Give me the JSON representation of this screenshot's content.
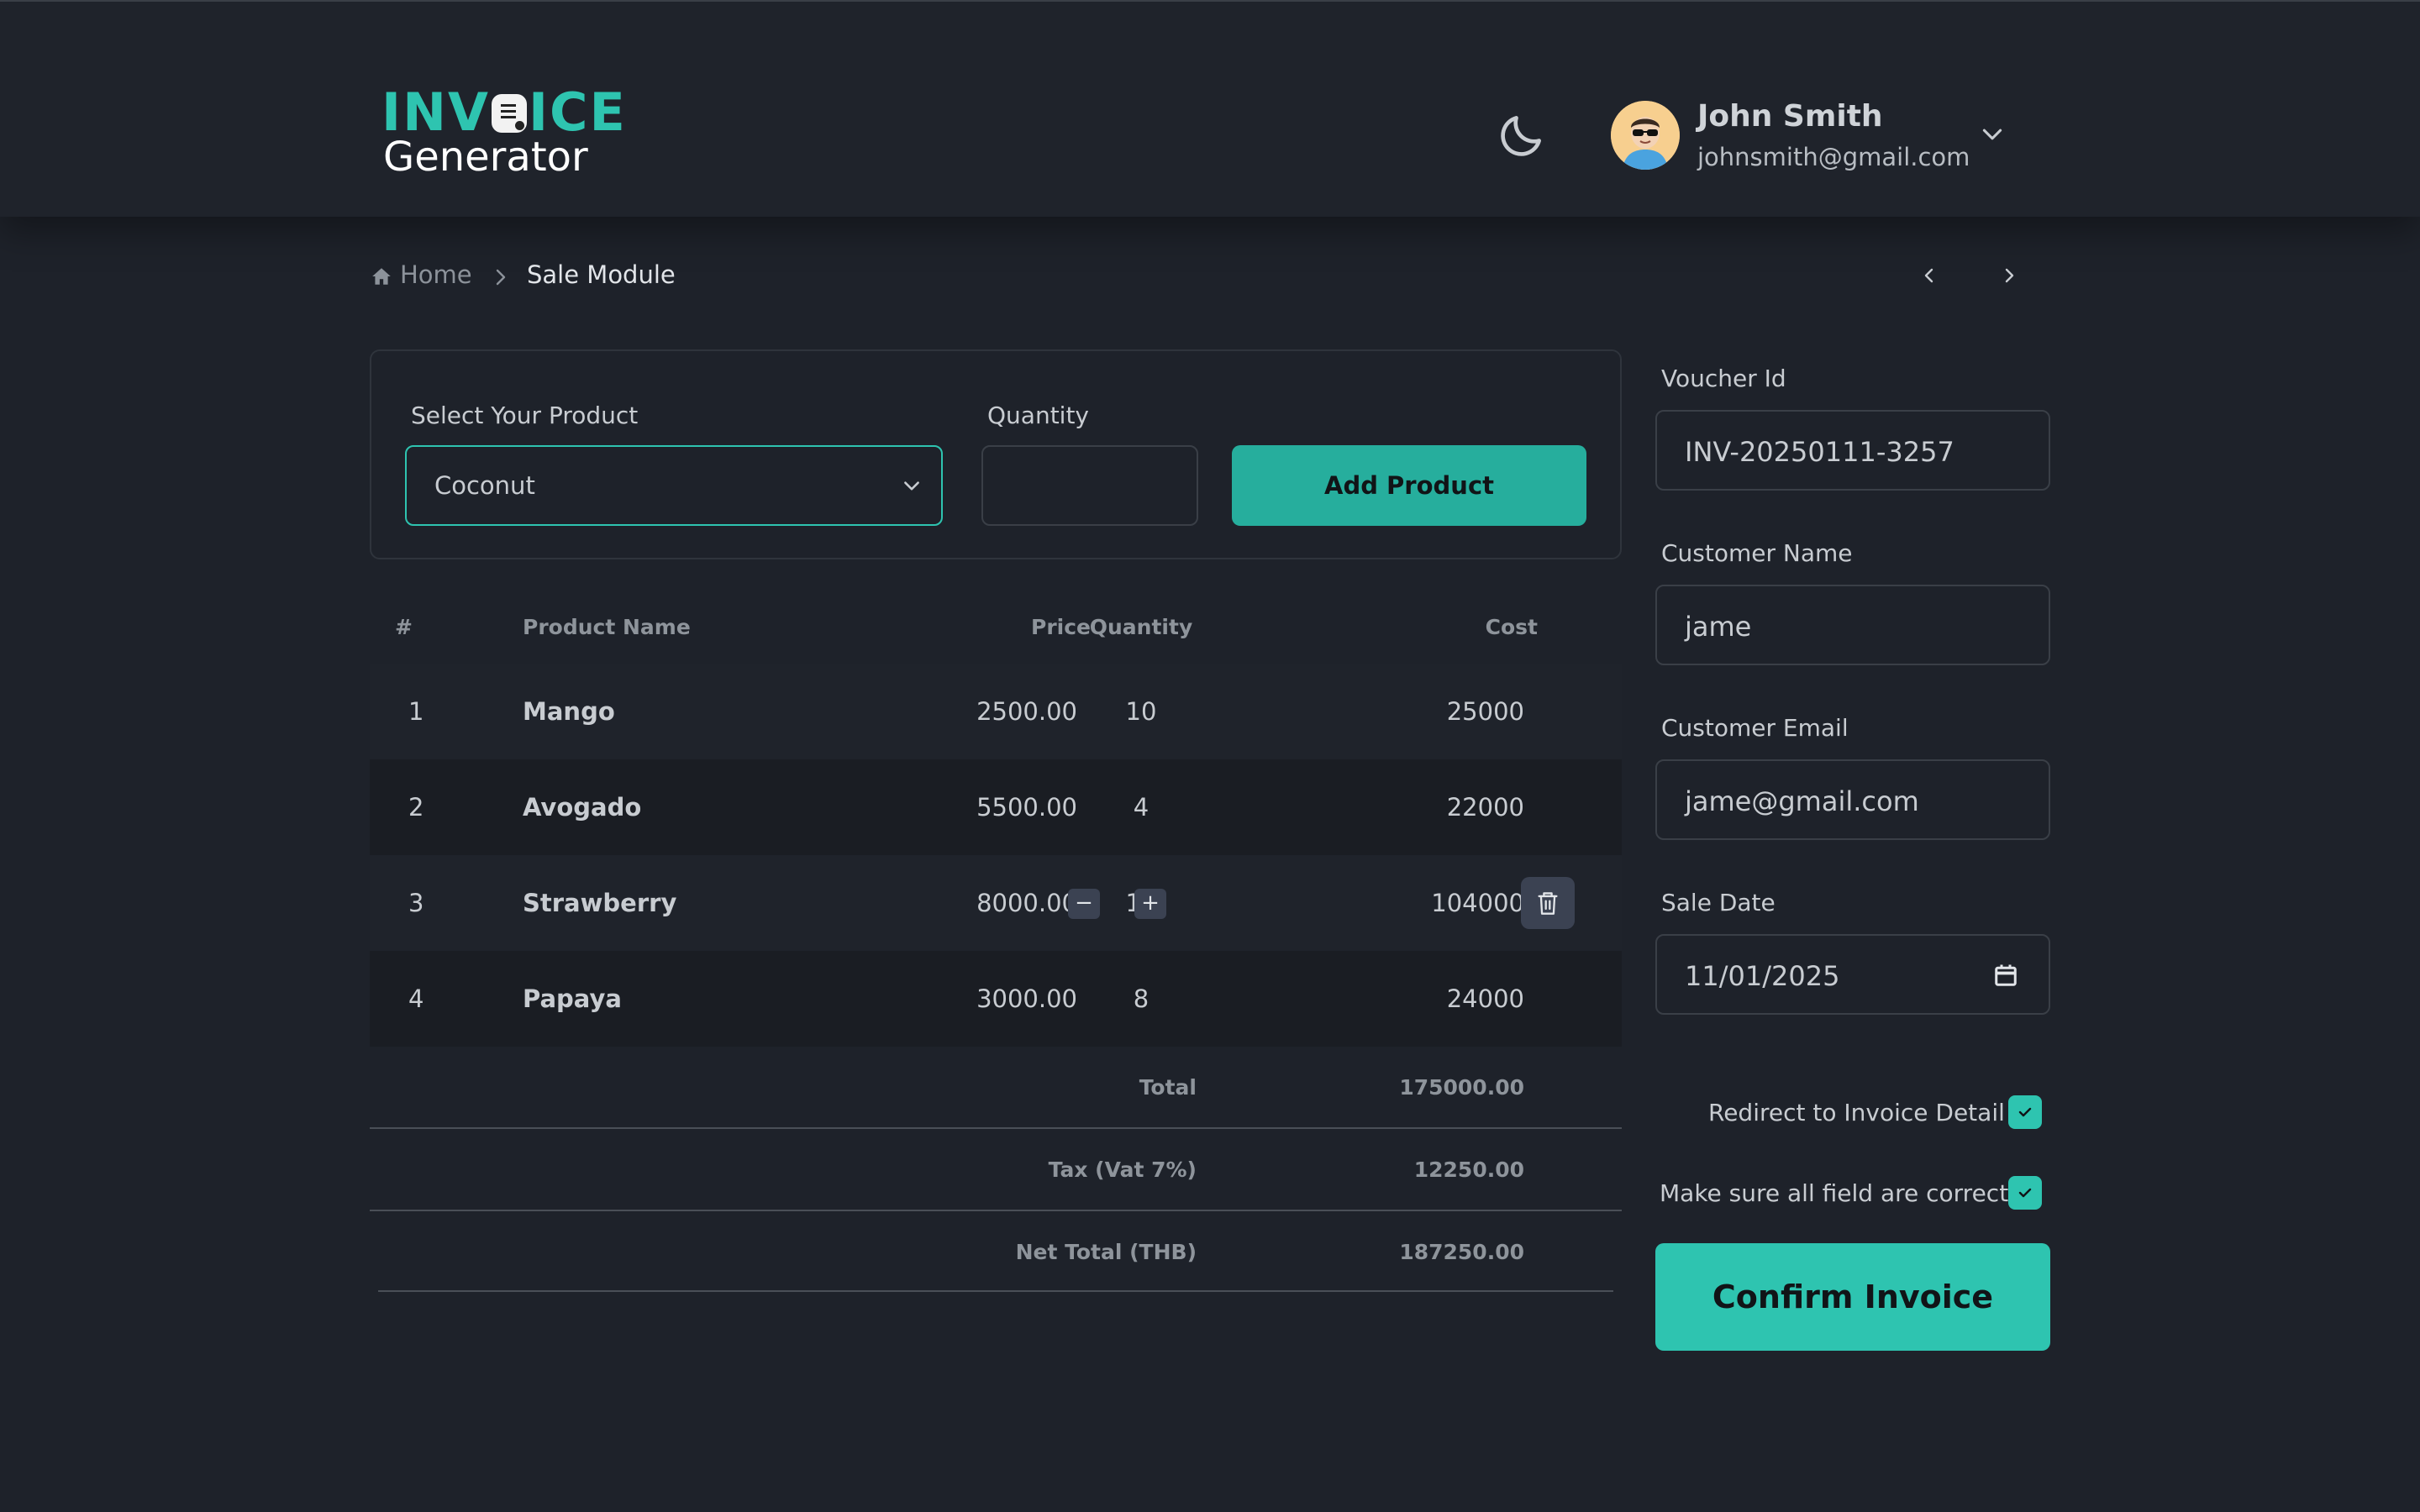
{
  "header": {
    "logo_top": [
      "INV",
      "ICE"
    ],
    "logo_bottom": "Generator",
    "user": {
      "name": "John Smith",
      "email": "johnsmith@gmail.com"
    }
  },
  "breadcrumb": {
    "home": "Home",
    "current": "Sale Module"
  },
  "product_form": {
    "product_label": "Select Your Product",
    "product_value": "Coconut",
    "quantity_label": "Quantity",
    "quantity_value": "",
    "add_button": "Add Product"
  },
  "table": {
    "headers": [
      "#",
      "Product Name",
      "Price",
      "Quantity",
      "Cost"
    ],
    "rows": [
      {
        "no": "1",
        "name": "Mango",
        "price": "2500.00",
        "qty": "10",
        "cost": "25000"
      },
      {
        "no": "2",
        "name": "Avogado",
        "price": "5500.00",
        "qty": "4",
        "cost": "22000"
      },
      {
        "no": "3",
        "name": "Strawberry",
        "price": "8000.00",
        "qty": "13",
        "cost": "104000"
      },
      {
        "no": "4",
        "name": "Papaya",
        "price": "3000.00",
        "qty": "8",
        "cost": "24000"
      }
    ],
    "stepper": {
      "minus": "−",
      "plus": "+"
    },
    "summary": [
      {
        "label": "Total",
        "value": "175000.00"
      },
      {
        "label": "Tax (Vat 7%)",
        "value": "12250.00"
      },
      {
        "label": "Net Total (THB)",
        "value": "187250.00"
      }
    ]
  },
  "invoice_form": {
    "voucher_label": "Voucher Id",
    "voucher_value": "INV-20250111-3257",
    "customer_name_label": "Customer Name",
    "customer_name_value": "jame",
    "customer_email_label": "Customer Email",
    "customer_email_value": "jame@gmail.com",
    "sale_date_label": "Sale Date",
    "sale_date_value": "11/01/2025",
    "redirect_label": "Redirect to Invoice Detail",
    "confirm_check_label": "Make sure all field are correct",
    "confirm_button": "Confirm Invoice"
  },
  "colors": {
    "accent": "#2ec4b0",
    "background": "#1e222a",
    "text": "#c8ccd1"
  },
  "icons": [
    "moon-icon",
    "home-icon",
    "chevron-right-icon",
    "chevron-left-icon",
    "chevron-down-icon",
    "trash-icon",
    "calendar-icon",
    "check-icon"
  ]
}
